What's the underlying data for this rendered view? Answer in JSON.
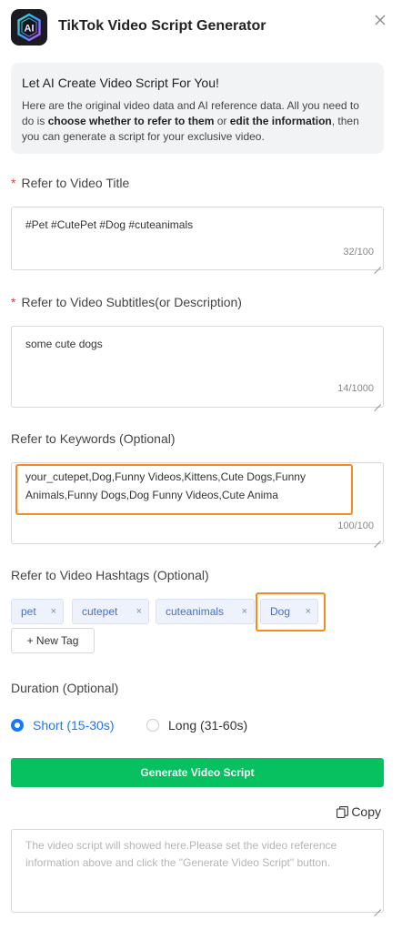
{
  "app": {
    "title": "TikTok Video Script Generator",
    "logo_text": "AI",
    "accent_color": "#07c160"
  },
  "intro": {
    "heading": "Let AI Create Video Script For You!",
    "text_part1": "Here are the original video data and AI reference data. All you need to do is ",
    "bold1": "choose whether to refer to them",
    "text_part2": " or ",
    "bold2": "edit the information",
    "text_part3": ", then you can generate a script for your exclusive video."
  },
  "title_field": {
    "required_mark": "*",
    "label": "Refer to Video Title",
    "value": "#Pet #CutePet #Dog #cuteanimals",
    "count": "32/100"
  },
  "subtitle_field": {
    "required_mark": "*",
    "label": "Refer to Video Subtitles(or Description)",
    "value": "some cute dogs",
    "count": "14/1000"
  },
  "keywords_field": {
    "label": "Refer to Keywords (Optional)",
    "value": "your_cutepet,Dog,Funny Videos,Kittens,Cute Dogs,Funny Animals,Funny Dogs,Dog Funny Videos,Cute Anima",
    "count": "100/100"
  },
  "hashtags": {
    "label": "Refer to Video Hashtags (Optional)",
    "tags": [
      "pet",
      "cutepet",
      "cuteanimals",
      "Dog"
    ],
    "remove_symbol": "×",
    "new_tag_label": "+ New Tag"
  },
  "duration": {
    "label": "Duration (Optional)",
    "options": [
      {
        "label": "Short (15-30s)",
        "selected": true
      },
      {
        "label": "Long (31-60s)",
        "selected": false
      }
    ]
  },
  "generate_button": {
    "label": "Generate Video Script"
  },
  "copy_button": {
    "label": "Copy"
  },
  "output": {
    "placeholder": "The video script will showed here.Please set the video reference information above and click the \"Generate Video Script\" button."
  }
}
